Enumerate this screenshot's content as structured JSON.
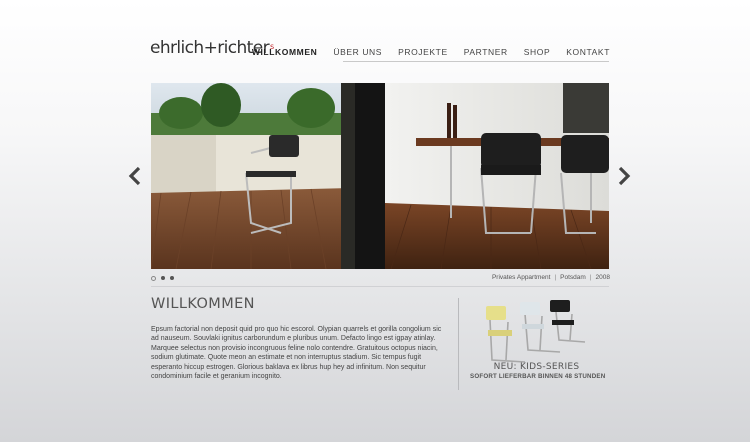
{
  "logo": {
    "main": "ehrlich+richter",
    "mark": "s"
  },
  "nav": {
    "items": [
      {
        "label": "WILLKOMMEN",
        "active": true
      },
      {
        "label": "ÜBER UNS"
      },
      {
        "label": "PROJEKTE"
      },
      {
        "label": "PARTNER"
      },
      {
        "label": "SHOP"
      },
      {
        "label": "KONTAKT"
      }
    ]
  },
  "slider": {
    "caption": {
      "project": "Privates Appartment",
      "city": "Potsdam",
      "year": "2008"
    },
    "dots": 3,
    "active_dot": 1
  },
  "content": {
    "title": "WILLKOMMEN",
    "body": "Epsum factorial non deposit quid pro quo hic escorol. Olypian quarrels et gorilla congolium sic ad nauseum. Souvlaki ignitus carborundum e pluribus unum. Defacto lingo est igpay atinlay. Marquee selectus non provisio incongruous feline nolo contendre. Gratuitous octopus niacin, sodium glutimate. Quote meon an estimate et non interruptus stadium. Sic tempus fugit esperanto hiccup estrogen. Glorious baklava ex librus hup hey ad infinitum. Non sequitur condominium facile et geranium incognito."
  },
  "promo": {
    "title": "NEU: KIDS-SERIES",
    "subtitle": "SOFORT LIEFERBAR BINNEN 48 STUNDEN"
  },
  "colors": {
    "accent": "#c0292e",
    "nav_text": "#444444",
    "body_text": "#444444"
  }
}
